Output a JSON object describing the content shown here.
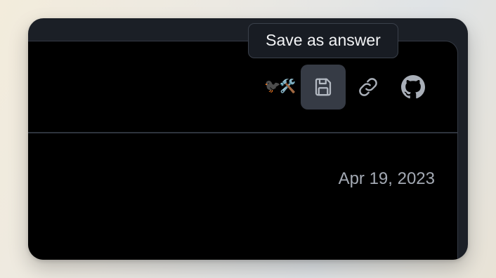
{
  "tooltip": {
    "text": "Save as answer"
  },
  "toolbar": {
    "emoji_label": "🐦‍⬛🛠️",
    "save_icon": "floppy-disk-icon",
    "link_icon": "link-icon",
    "github_icon": "github-icon",
    "active_color": "#363b45"
  },
  "content": {
    "date": "Apr 19, 2023"
  },
  "colors": {
    "card_bg": "#1b1f26",
    "panel_bg": "#000000",
    "icon_color": "#a9afb8",
    "date_color": "#a3a9b3"
  }
}
